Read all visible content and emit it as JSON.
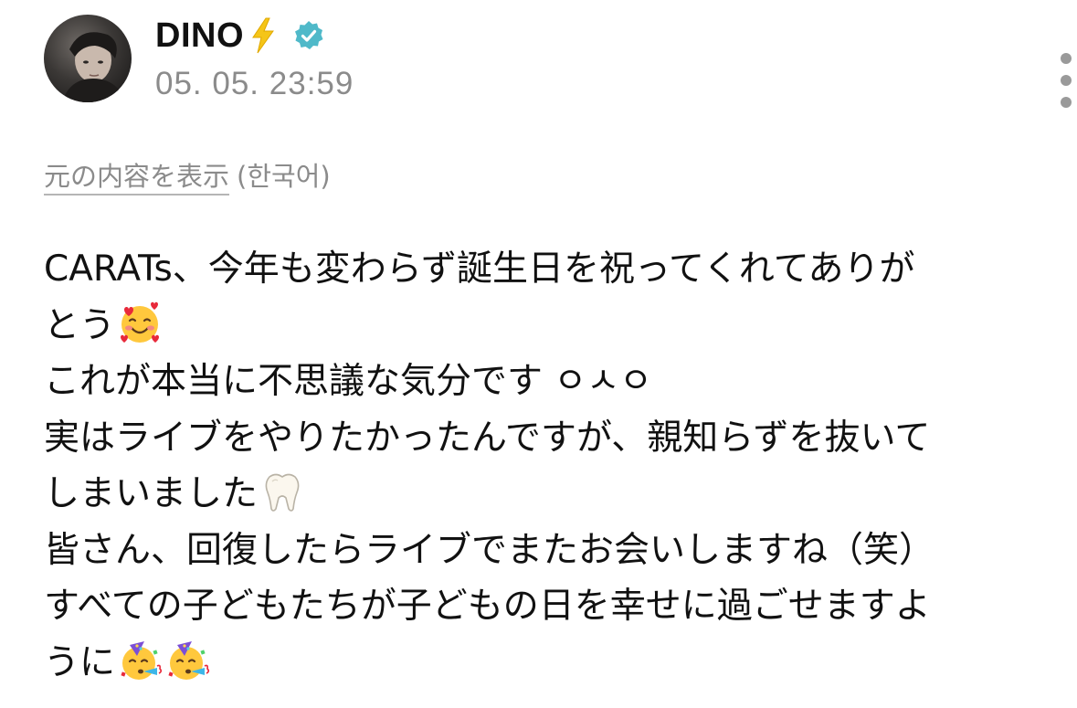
{
  "post": {
    "author": {
      "name": "DINO",
      "name_emoji": "lightning-icon",
      "verified_icon": "verified-badge-icon",
      "avatar": "profile-photo"
    },
    "timestamp": "05. 05. 23:59",
    "menu_icon": "more-vertical-icon",
    "translation": {
      "show_original_label": "元の内容を表示",
      "language_note": "(한국어)"
    },
    "body_lines": [
      {
        "text": "CARATs、今年も変わらず誕生日を祝ってくれてありが",
        "emojis": []
      },
      {
        "text": "とう",
        "emojis": [
          "smiling-face-with-hearts"
        ]
      },
      {
        "text": "これが本当に不思議な気分です ㅇㅅㅇ",
        "emojis": []
      },
      {
        "text": "実はライブをやりたかったんですが、親知らずを抜いて",
        "emojis": []
      },
      {
        "text": "しまいました",
        "emojis": [
          "tooth"
        ]
      },
      {
        "text": "皆さん、回復したらライブでまたお会いしますね（笑）",
        "emojis": []
      },
      {
        "text": "すべての子どもたちが子どもの日を幸せに過ごせますよ",
        "emojis": []
      },
      {
        "text": "うに",
        "emojis": [
          "partying-face",
          "partying-face"
        ]
      }
    ]
  },
  "colors": {
    "text_primary": "#111111",
    "text_secondary": "#8b8b8b",
    "verified_badge": "#4fb9c9",
    "lightning": "#f5c518",
    "background": "#ffffff"
  }
}
